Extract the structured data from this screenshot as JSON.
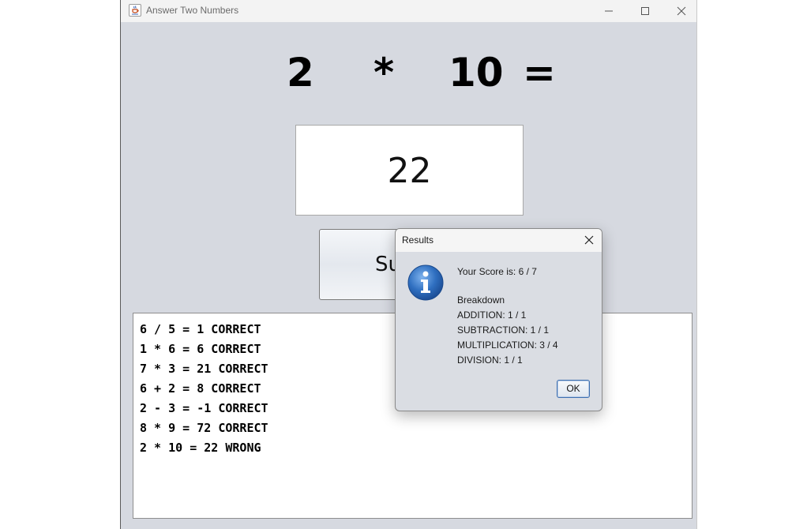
{
  "window": {
    "title": "Answer Two Numbers"
  },
  "question": {
    "operand1": "2",
    "operator": "*",
    "operand2": "10",
    "equals": "="
  },
  "answer_field": {
    "value": "22"
  },
  "submit_button": {
    "visible_label": "Su"
  },
  "log": {
    "lines": [
      "6 / 5 = 1 CORRECT",
      "1 * 6 = 6 CORRECT",
      "7 * 3 = 21 CORRECT",
      "6 + 2 = 8 CORRECT",
      "2 - 3 = -1 CORRECT",
      "8 * 9 = 72 CORRECT",
      "2 * 10 = 22 WRONG"
    ]
  },
  "dialog": {
    "title": "Results",
    "score": "Your Score is: 6 / 7",
    "breakdown_header": "Breakdown",
    "addition": "ADDITION: 1 / 1",
    "subtraction": "SUBTRACTION: 1 / 1",
    "multiplication": "MULTIPLICATION: 3 / 4",
    "division": "DIVISION: 1 / 1",
    "ok_label": "OK"
  },
  "icons": {
    "app": "java-coffee-cup-icon",
    "minimize": "minimize-icon",
    "maximize": "maximize-icon",
    "close": "close-icon",
    "info": "info-icon"
  },
  "colors": {
    "window_bg": "#d6d9e0",
    "info_blue": "#2f6fc0",
    "ok_border": "#3d6fb0"
  }
}
